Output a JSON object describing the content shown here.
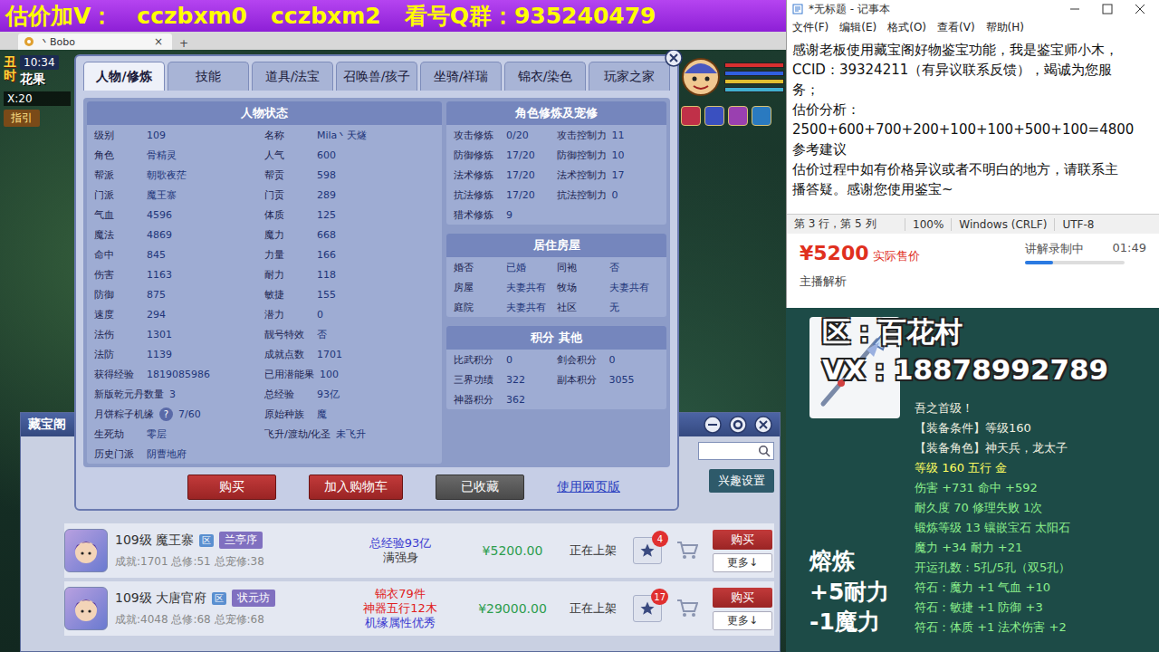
{
  "banner": {
    "segments": [
      "估价加V：",
      "cczbxm0",
      "cczbxm2",
      "看号Q群：935240479"
    ]
  },
  "game_window": {
    "tab_title": "丶Bobo",
    "tab_close": "×",
    "new_tab": "+"
  },
  "hud": {
    "time": "10:34",
    "shichen": "丑时",
    "location": "花果",
    "coords": "X:20",
    "guide": "指引"
  },
  "character_panel": {
    "tabs": [
      {
        "label": "人物/修炼",
        "selected": true
      },
      {
        "label": "技能",
        "selected": false
      },
      {
        "label": "道具/法宝",
        "selected": false
      },
      {
        "label": "召唤兽/孩子",
        "selected": false
      },
      {
        "label": "坐骑/祥瑞",
        "selected": false
      },
      {
        "label": "锦衣/染色",
        "selected": false
      },
      {
        "label": "玩家之家",
        "selected": false
      }
    ],
    "status": {
      "title": "人物状态",
      "rows": [
        [
          {
            "label": "级别",
            "value": "109"
          },
          {
            "label": "名称",
            "value": "Mila丶天燧"
          }
        ],
        [
          {
            "label": "角色",
            "value": "骨精灵"
          },
          {
            "label": "人气",
            "value": "600"
          }
        ],
        [
          {
            "label": "帮派",
            "value": "朝歌夜茫"
          },
          {
            "label": "帮贡",
            "value": "598"
          }
        ],
        [
          {
            "label": "门派",
            "value": "魔王寨"
          },
          {
            "label": "门贡",
            "value": "289"
          }
        ],
        [
          {
            "label": "气血",
            "value": "4596"
          },
          {
            "label": "体质",
            "value": "125"
          }
        ],
        [
          {
            "label": "魔法",
            "value": "4869"
          },
          {
            "label": "魔力",
            "value": "668"
          }
        ],
        [
          {
            "label": "命中",
            "value": "845"
          },
          {
            "label": "力量",
            "value": "166"
          }
        ],
        [
          {
            "label": "伤害",
            "value": "1163"
          },
          {
            "label": "耐力",
            "value": "118"
          }
        ],
        [
          {
            "label": "防御",
            "value": "875"
          },
          {
            "label": "敏捷",
            "value": "155"
          }
        ],
        [
          {
            "label": "速度",
            "value": "294"
          },
          {
            "label": "潜力",
            "value": "0"
          }
        ],
        [
          {
            "label": "法伤",
            "value": "1301"
          },
          {
            "label": "靓号特效",
            "value": "否"
          }
        ],
        [
          {
            "label": "法防",
            "value": "1139"
          },
          {
            "label": "成就点数",
            "value": "1701"
          }
        ],
        [
          {
            "label": "获得经验",
            "value": "1819085986"
          },
          {
            "label": "已用潜能果",
            "value": "100"
          }
        ],
        [
          {
            "label": "新版乾元丹数量",
            "value": "3"
          },
          {
            "label": "总经验",
            "value": "93亿"
          }
        ],
        [
          {
            "label": "月饼粽子机缘",
            "hint": "?",
            "value": "7/60"
          },
          {
            "label": "原始种族",
            "value": "魔"
          }
        ],
        [
          {
            "label": "生死劫",
            "value": "零层"
          },
          {
            "label": "飞升/渡劫/化圣",
            "value": "未飞升"
          }
        ],
        [
          {
            "label": "历史门派",
            "value": "阴曹地府"
          }
        ]
      ]
    },
    "side_sections": [
      {
        "title": "角色修炼及宠修",
        "rows": [
          [
            {
              "label": "攻击修炼",
              "value": "0/20"
            },
            {
              "label": "攻击控制力",
              "value": "11"
            }
          ],
          [
            {
              "label": "防御修炼",
              "value": "17/20"
            },
            {
              "label": "防御控制力",
              "value": "10"
            }
          ],
          [
            {
              "label": "法术修炼",
              "value": "17/20"
            },
            {
              "label": "法术控制力",
              "value": "17"
            }
          ],
          [
            {
              "label": "抗法修炼",
              "value": "17/20"
            },
            {
              "label": "抗法控制力",
              "value": "0"
            }
          ],
          [
            {
              "label": "猎术修炼",
              "value": "9"
            }
          ]
        ]
      },
      {
        "title": "居住房屋",
        "rows": [
          [
            {
              "label": "婚否",
              "value": "已婚"
            },
            {
              "label": "同袍",
              "value": "否"
            }
          ],
          [
            {
              "label": "房屋",
              "value": "夫妻共有"
            },
            {
              "label": "牧场",
              "value": "夫妻共有"
            }
          ],
          [
            {
              "label": "庭院",
              "value": "夫妻共有"
            },
            {
              "label": "社区",
              "value": "无"
            }
          ]
        ]
      },
      {
        "title": "积分 其他",
        "rows": [
          [
            {
              "label": "比武积分",
              "value": "0"
            },
            {
              "label": "剑会积分",
              "value": "0"
            }
          ],
          [
            {
              "label": "三界功绩",
              "value": "322"
            },
            {
              "label": "副本积分",
              "value": "3055"
            }
          ],
          [
            {
              "label": "神器积分",
              "value": "362"
            }
          ]
        ]
      }
    ],
    "buttons": [
      {
        "label": "购买",
        "kind": "primary"
      },
      {
        "label": "加入购物车",
        "kind": "primary"
      },
      {
        "label": "已收藏",
        "kind": "muted"
      }
    ],
    "link": "使用网页版"
  },
  "market": {
    "title": "藏宝阁",
    "interest_button": "兴趣设置",
    "listings": [
      {
        "name": "109级 魔王寨",
        "server_badge": "区",
        "server": "兰亭序",
        "stats": "成就:1701 总修:51 总宠修:38",
        "highlights": [
          {
            "text": "总经验93亿",
            "color": "#3a3ad0"
          },
          {
            "text": "满强身",
            "color": "#333333"
          }
        ],
        "price": "¥5200.00",
        "status": "正在上架",
        "favorites": "4",
        "buy": "购买",
        "more": "更多↓"
      },
      {
        "name": "109级 大唐官府",
        "server_badge": "区",
        "server": "状元坊",
        "stats": "成就:4048 总修:68 总宠修:68",
        "highlights": [
          {
            "text": "锦衣79件",
            "color": "#e02020"
          },
          {
            "text": "神器五行12木",
            "color": "#e02020"
          },
          {
            "text": "机缘属性优秀",
            "color": "#3a3ad0"
          }
        ],
        "price": "¥29000.00",
        "status": "正在上架",
        "favorites": "17",
        "buy": "购买",
        "more": "更多↓"
      }
    ]
  },
  "notepad": {
    "title": "*无标题 - 记事本",
    "menu": [
      "文件(F)",
      "编辑(E)",
      "格式(O)",
      "查看(V)",
      "帮助(H)"
    ],
    "lines": [
      "感谢老板使用藏宝阁好物鉴宝功能，我是鉴宝师小木，",
      "CCID：39324211（有异议联系反馈），竭诚为您服",
      "务；",
      "估价分析：",
      "2500+600+700+200+100+100+500+100=4800",
      "参考建议",
      "估价过程中如有价格异议或者不明白的地方，请联系主",
      "播答疑。感谢您使用鉴宝~"
    ],
    "status": [
      "第 3 行，第 5 列",
      "100%",
      "Windows (CRLF)",
      "UTF-8"
    ]
  },
  "price_panel": {
    "price": "¥5200",
    "price_label": "实际售价",
    "recording": "讲解录制中",
    "elapsed": "01:49",
    "level": 0.28,
    "section": "主播解析"
  },
  "item_panel": {
    "overlay": [
      "区：百花村",
      "VX：18878992789"
    ],
    "lines": [
      {
        "text": "吾之首级！",
        "color": "#f0f0e0"
      },
      {
        "text": "【装备条件】等级160",
        "color": "#f0f0e0"
      },
      {
        "text": "【装备角色】神天兵，龙太子",
        "color": "#f0f0e0"
      },
      {
        "text": "等级 160 五行 金",
        "color": "#ffff60"
      },
      {
        "text": "伤害 +731 命中 +592",
        "color": "#8cf08c"
      },
      {
        "text": "耐久度 70 修理失败 1次",
        "color": "#8cf08c"
      },
      {
        "text": "锻炼等级 13 镶嵌宝石 太阳石",
        "color": "#8cf08c"
      },
      {
        "text": "魔力 +34 耐力 +21",
        "color": "#8cf08c"
      },
      {
        "text": "开运孔数：5孔/5孔（双5孔）",
        "color": "#8cf08c"
      },
      {
        "text": "符石：魔力 +1 气血 +10",
        "color": "#8cf08c"
      },
      {
        "text": "符石：敏捷 +1 防御 +3",
        "color": "#8cf08c"
      },
      {
        "text": "符石：体质 +1 法术伤害 +2",
        "color": "#8cf08c"
      }
    ],
    "smelt": [
      "熔炼",
      "+5耐力",
      "-1魔力"
    ]
  }
}
